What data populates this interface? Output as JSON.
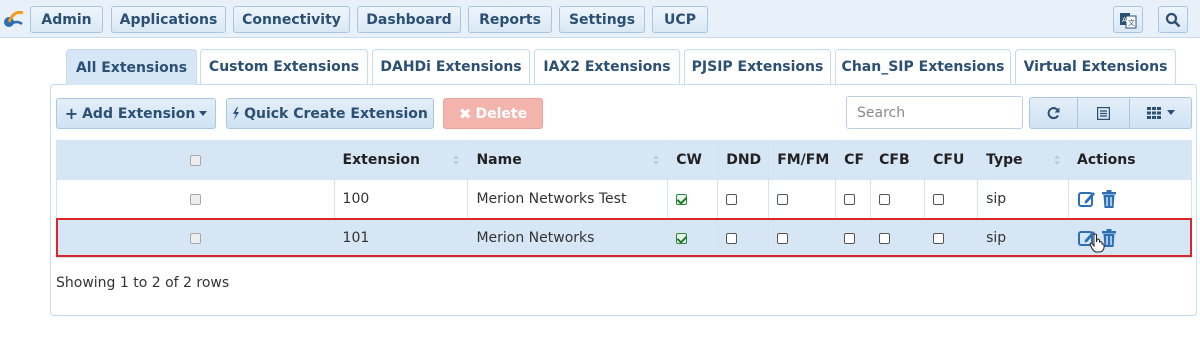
{
  "nav": {
    "items": [
      "Admin",
      "Applications",
      "Connectivity",
      "Dashboard",
      "Reports",
      "Settings",
      "UCP"
    ]
  },
  "tabs": [
    "All Extensions",
    "Custom Extensions",
    "DAHDi Extensions",
    "IAX2 Extensions",
    "PJSIP Extensions",
    "Chan_SIP Extensions",
    "Virtual Extensions"
  ],
  "active_tab": "All Extensions",
  "toolbar": {
    "add_label": "Add Extension",
    "quick_label": "Quick Create Extension",
    "delete_label": "Delete",
    "search_placeholder": "Search"
  },
  "table": {
    "headers": [
      "",
      "Extension",
      "Name",
      "CW",
      "DND",
      "FM/FM",
      "CF",
      "CFB",
      "CFU",
      "Type",
      "Actions"
    ],
    "rows": [
      {
        "extension": "100",
        "name": "Merion Networks Test",
        "cw": true,
        "dnd": false,
        "fmfm": false,
        "cf": false,
        "cfb": false,
        "cfu": false,
        "type": "sip"
      },
      {
        "extension": "101",
        "name": "Merion Networks",
        "cw": true,
        "dnd": false,
        "fmfm": false,
        "cf": false,
        "cfb": false,
        "cfu": false,
        "type": "sip"
      }
    ]
  },
  "footer": {
    "rows_text": "Showing 1 to 2 of 2 rows"
  },
  "colors": {
    "accent": "#2c4f74",
    "header_bg": "#d6e6f5",
    "delete_bg": "#f2b4ad",
    "highlight": "#d9262a"
  }
}
